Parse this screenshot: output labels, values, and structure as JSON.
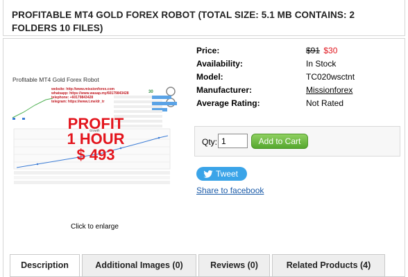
{
  "product": {
    "title": "PROFITABLE MT4 GOLD FOREX ROBOT (TOTAL SIZE: 5.1 MB CONTAINS: 2 FOLDERS 10 FILES)",
    "image": {
      "heading": "Profitable MT4 Gold Forex Robot",
      "contact_lines": [
        "website: http://www.missionforex.com",
        "whatsapp: https://www.wasap.my/60179843428",
        "telephone: +60179843428",
        "telegram: https://www.t.me/dr_tr"
      ],
      "stat_value": "30",
      "overlay_lines": [
        "PROFIT",
        "1 HOUR",
        "$ 493"
      ],
      "growth_label": "Growth"
    },
    "click_to_enlarge": "Click to enlarge"
  },
  "details": {
    "price_label": "Price:",
    "old_price": "$91",
    "new_price": "$30",
    "availability_label": "Availability:",
    "availability_value": "In Stock",
    "model_label": "Model:",
    "model_value": "TC020wsctnt",
    "manufacturer_label": "Manufacturer:",
    "manufacturer_value": "Missionforex",
    "rating_label": "Average Rating:",
    "rating_value": "Not Rated"
  },
  "cart": {
    "qty_label": "Qty:",
    "qty_value": "1",
    "add_to_cart_label": "Add to Cart"
  },
  "social": {
    "tweet_label": "Tweet",
    "facebook_label": "Share to facebook"
  },
  "tabs": [
    {
      "label": "Description"
    },
    {
      "label": "Additional Images (0)"
    },
    {
      "label": "Reviews (0)"
    },
    {
      "label": "Related Products (4)"
    }
  ],
  "colors": {
    "price_accent": "#e0151d",
    "link": "#1a5aa8",
    "cart_button": "#55a72e",
    "tweet_button": "#3aa4e8"
  }
}
